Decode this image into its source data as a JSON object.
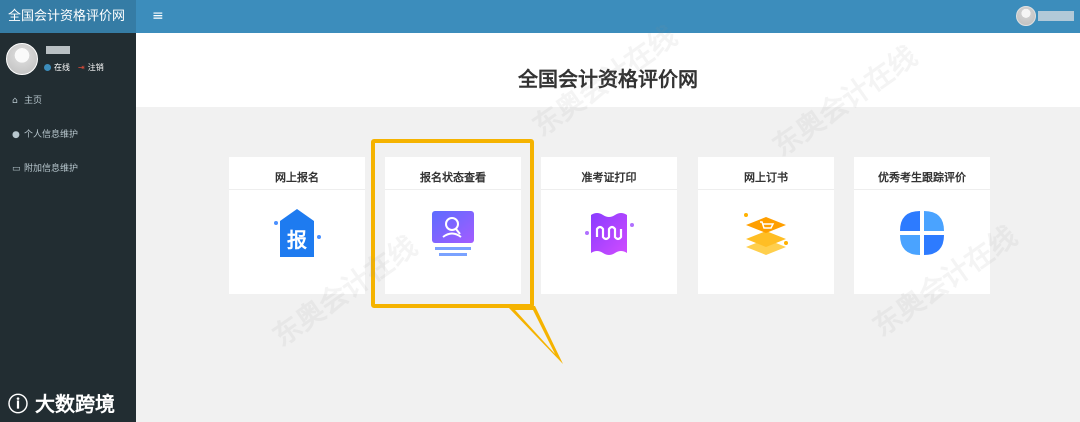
{
  "header": {
    "brand": "全国会计资格评价网",
    "menu_icon": "hamburger-icon",
    "user_avatar_icon": "user-avatar-icon"
  },
  "sidebar": {
    "status_online": "在线",
    "logout": "注销",
    "menu": [
      {
        "label": "主页",
        "icon": "home-icon"
      },
      {
        "label": "个人信息维护",
        "icon": "user-icon"
      },
      {
        "label": "附加信息维护",
        "icon": "id-card-icon"
      }
    ]
  },
  "main": {
    "title": "全国会计资格评价网",
    "cards": [
      {
        "title": "网上报名",
        "icon": "register-icon",
        "glyph": "报"
      },
      {
        "title": "报名状态查看",
        "icon": "search-status-icon"
      },
      {
        "title": "准考证打印",
        "icon": "admission-ticket-icon"
      },
      {
        "title": "网上订书",
        "icon": "book-order-icon"
      },
      {
        "title": "优秀考生跟踪评价",
        "icon": "evaluation-icon"
      }
    ]
  },
  "watermark_text": "东奥会计在线",
  "bottom_logo_text": "大数跨境",
  "colors": {
    "topbar": "#3c8dbc",
    "sidebar": "#222d32",
    "highlight": "#f5b300"
  }
}
